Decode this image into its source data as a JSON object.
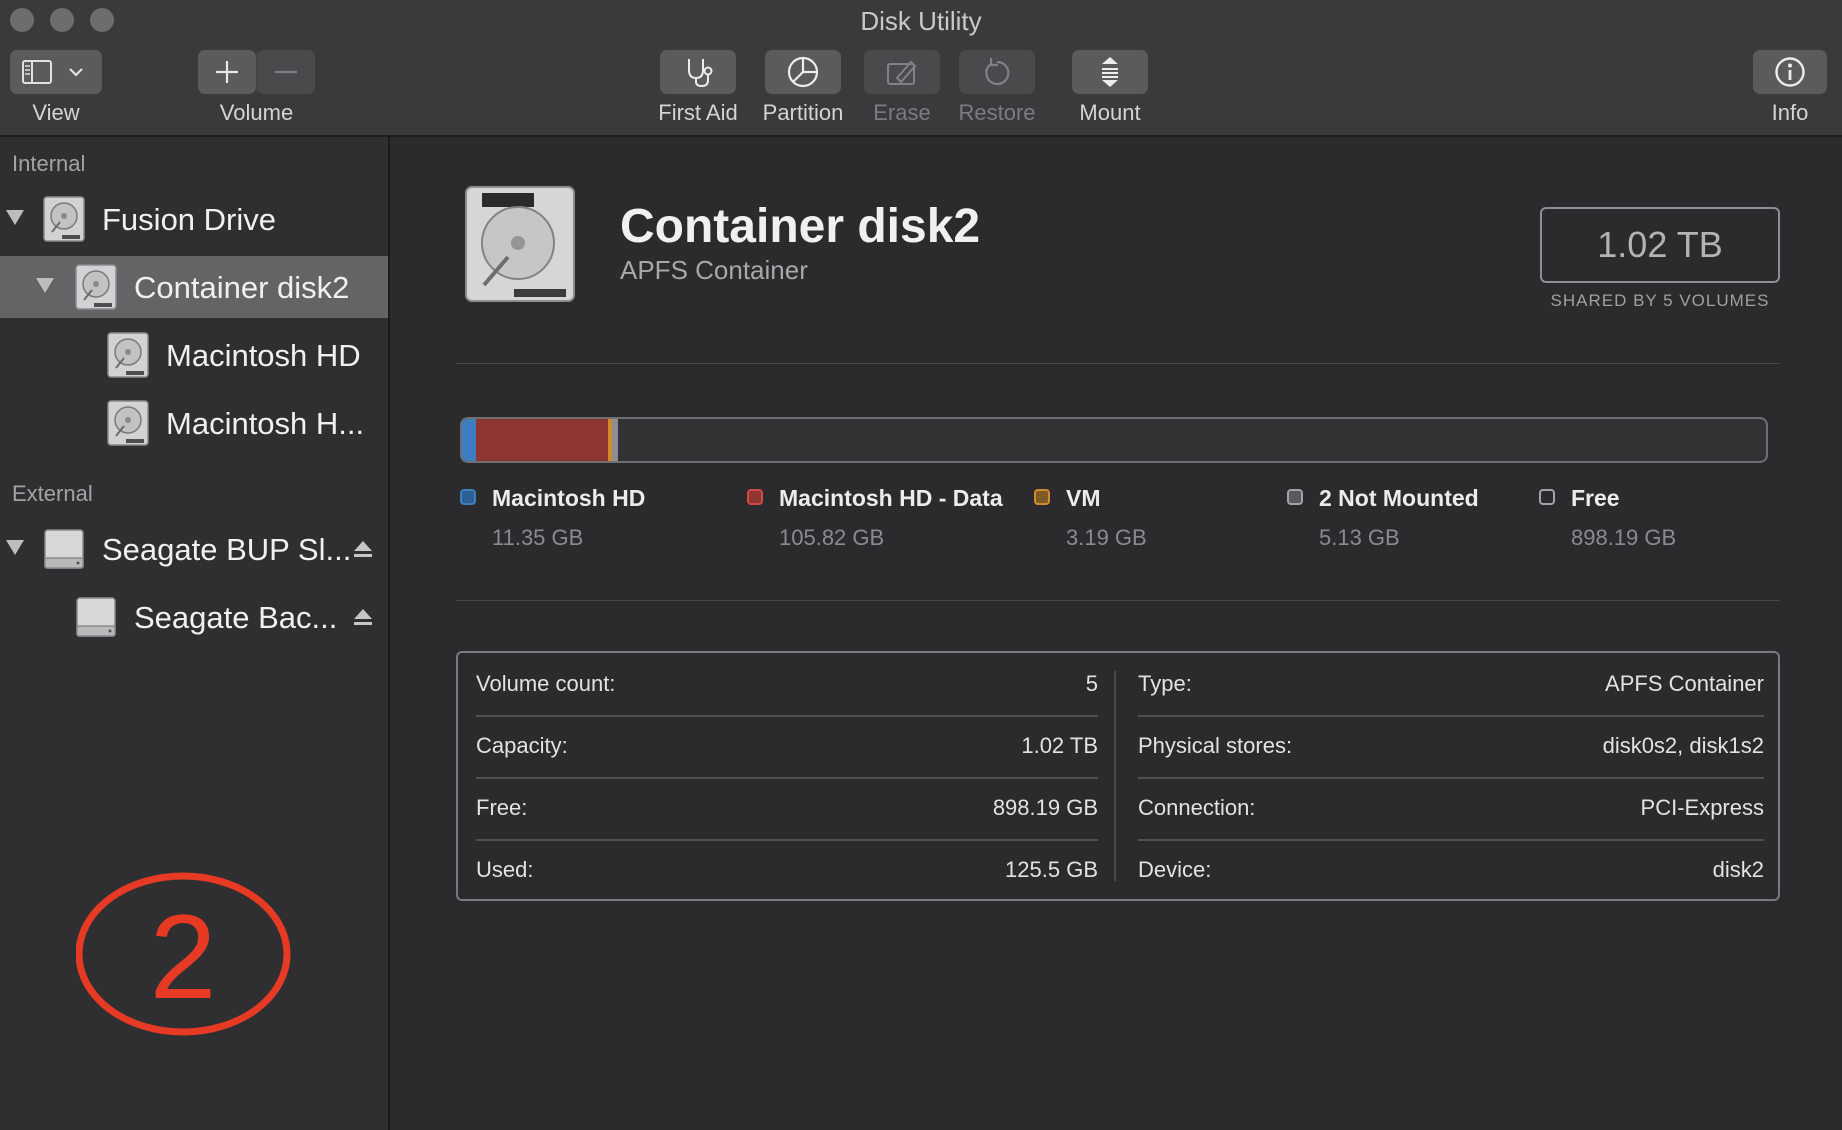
{
  "window": {
    "title": "Disk Utility"
  },
  "toolbar": {
    "view_label": "View",
    "volume_label": "Volume",
    "first_aid_label": "First Aid",
    "partition_label": "Partition",
    "erase_label": "Erase",
    "restore_label": "Restore",
    "mount_label": "Mount",
    "info_label": "Info",
    "icons": {
      "view": "sidebar-toggle-icon",
      "volume_add": "plus-icon",
      "volume_remove": "minus-icon",
      "first_aid": "stethoscope-icon",
      "partition": "pie-chart-icon",
      "erase": "eraser-icon",
      "restore": "restore-arrow-icon",
      "mount": "mount-icon",
      "info": "info-icon"
    }
  },
  "sidebar": {
    "internal_header": "Internal",
    "external_header": "External",
    "items": [
      {
        "label": "Fusion Drive",
        "icon": "hard-disk-icon",
        "expanded": true
      },
      {
        "label": "Container disk2",
        "icon": "hard-disk-icon",
        "expanded": true,
        "selected": true
      },
      {
        "label": "Macintosh HD",
        "icon": "hard-disk-icon"
      },
      {
        "label": "Macintosh H...",
        "icon": "hard-disk-icon"
      },
      {
        "label": "Seagate BUP Sl...",
        "icon": "external-drive-icon",
        "expanded": true,
        "eject": true
      },
      {
        "label": "Seagate Bac...",
        "icon": "external-drive-icon",
        "eject": true
      }
    ],
    "annotation": "2"
  },
  "container": {
    "title": "Container disk2",
    "subtitle": "APFS Container",
    "size": "1.02 TB",
    "size_caption": "SHARED BY 5 VOLUMES"
  },
  "usage": {
    "colors": {
      "macintosh_hd": "#3d7ec0",
      "data": "#8f3532",
      "vm": "#d28a2c",
      "not_mounted": "#8e8e92",
      "free": "#323234"
    },
    "fractions": {
      "macintosh_hd": 0.011,
      "data": 0.101,
      "vm": 0.0031,
      "not_mounted": 0.0049
    },
    "legend": [
      {
        "name": "Macintosh HD",
        "value": "11.35 GB"
      },
      {
        "name": "Macintosh HD - Data",
        "value": "105.82 GB"
      },
      {
        "name": "VM",
        "value": "3.19 GB"
      },
      {
        "name": "2 Not Mounted",
        "value": "5.13 GB"
      },
      {
        "name": "Free",
        "value": "898.19 GB"
      }
    ]
  },
  "info": {
    "left": [
      {
        "key": "Volume count:",
        "value": "5"
      },
      {
        "key": "Capacity:",
        "value": "1.02 TB"
      },
      {
        "key": "Free:",
        "value": "898.19 GB"
      },
      {
        "key": "Used:",
        "value": "125.5 GB"
      }
    ],
    "right": [
      {
        "key": "Type:",
        "value": "APFS Container"
      },
      {
        "key": "Physical stores:",
        "value": "disk0s2, disk1s2"
      },
      {
        "key": "Connection:",
        "value": "PCI-Express"
      },
      {
        "key": "Device:",
        "value": "disk2"
      }
    ]
  }
}
